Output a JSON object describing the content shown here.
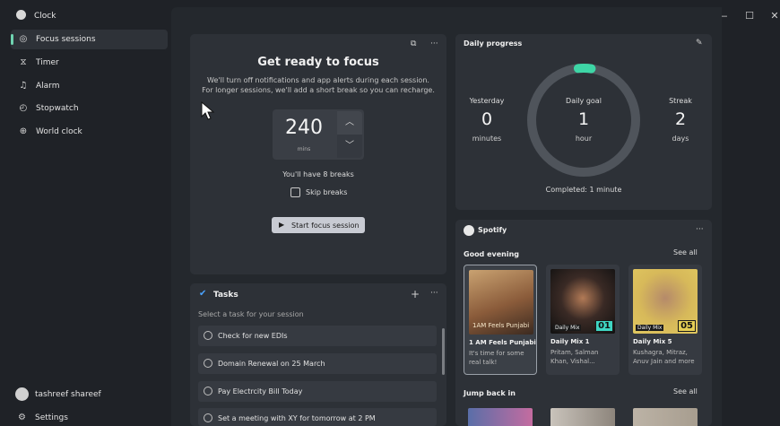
{
  "window": {
    "title": "Clock",
    "minimize": "—",
    "maximize": "☐",
    "close": "✕"
  },
  "sidebar": {
    "items": [
      {
        "label": "Focus sessions",
        "icon": "focus-icon"
      },
      {
        "label": "Timer",
        "icon": "hourglass-icon"
      },
      {
        "label": "Alarm",
        "icon": "bell-icon"
      },
      {
        "label": "Stopwatch",
        "icon": "stopwatch-icon"
      },
      {
        "label": "World clock",
        "icon": "globe-icon"
      }
    ],
    "active_index": 0,
    "profile": {
      "name": "tashreef shareef"
    },
    "settings_label": "Settings"
  },
  "focus": {
    "title": "Get ready to focus",
    "description": "We'll turn off notifications and app alerts during each session. For longer sessions, we'll add a short break so you can recharge.",
    "minutes": "240",
    "unit": "mins",
    "breaks_text": "You'll have 8 breaks",
    "skip_label": "Skip breaks",
    "start_label": "Start focus session"
  },
  "tasks": {
    "title": "Tasks",
    "hint": "Select a task for your session",
    "items": [
      "Check for new EDIs",
      "Domain Renewal on 25 March",
      "Pay Electrcity Bill Today",
      "Set a meeting with XY for tomorrow at 2 PM"
    ],
    "add": "+",
    "more": "···"
  },
  "progress": {
    "title": "Daily progress",
    "yesterday": {
      "label": "Yesterday",
      "value": "0",
      "unit": "minutes"
    },
    "goal": {
      "label": "Daily goal",
      "value": "1",
      "unit": "hour"
    },
    "streak": {
      "label": "Streak",
      "value": "2",
      "unit": "days"
    },
    "completed": "Completed: 1 minute",
    "goal_fraction": 0.017,
    "colors": {
      "ring": "#4f545b",
      "accent": "#3ed6a6"
    }
  },
  "spotify": {
    "title": "Spotify",
    "more": "···",
    "section1": "Good evening",
    "section2": "Jump back in",
    "see_all": "See all",
    "albums": [
      {
        "name": "1 AM Feels Punjabi",
        "sub": "It's time for some real talk!",
        "art_text": "1AM Feels Punjabi"
      },
      {
        "name": "Daily Mix 1",
        "sub": "Pritam, Salman Khan, Vishal...",
        "tag": "Daily Mix",
        "num": "01"
      },
      {
        "name": "Daily Mix 5",
        "sub": "Kushagra, Mitraz, Anuv Jain and more",
        "tag": "Daily Mix",
        "num": "05"
      }
    ]
  }
}
